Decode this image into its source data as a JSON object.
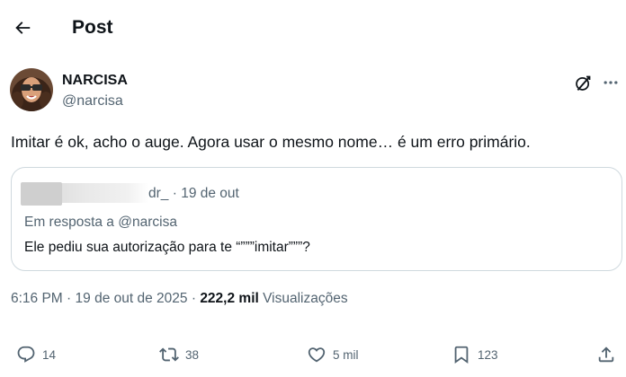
{
  "header": {
    "title": "Post",
    "back_icon": "arrow-left-icon"
  },
  "author": {
    "display_name": "NARCISA",
    "handle": "@narcisa",
    "avatar_icon": "profile-photo"
  },
  "tweet": {
    "text": "Imitar é ok, acho o auge. Agora usar o mesmo nome… é um erro primário."
  },
  "quoted_tweet": {
    "handle_fragment": "dr_",
    "separator": "·",
    "date": "19 de out",
    "reply_context": "Em resposta a @narcisa",
    "text": "Ele pediu sua autorização para te “”””imitar”””?"
  },
  "meta": {
    "time": "6:16 PM",
    "separator": "·",
    "date": "19 de out de 2025",
    "views_count": "222,2 mil",
    "views_label": "Visualizações"
  },
  "actions": {
    "replies": "14",
    "reposts": "38",
    "likes": "5 mil",
    "bookmarks": "123"
  },
  "colors": {
    "text": "#0f1419",
    "secondary": "#536471",
    "border": "#cfd9de"
  }
}
